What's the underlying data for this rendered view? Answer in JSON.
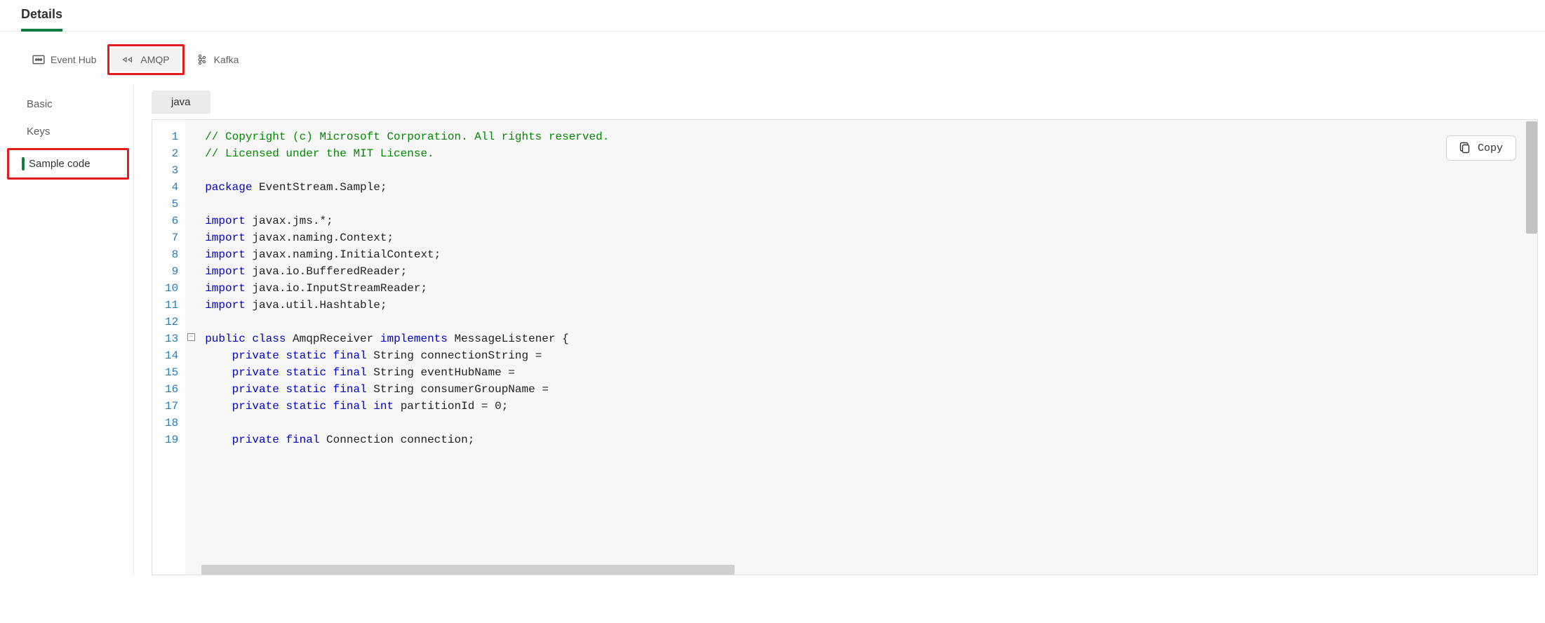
{
  "header": {
    "title": "Details"
  },
  "protocol_tabs": {
    "event_hub": "Event Hub",
    "amqp": "AMQP",
    "kafka": "Kafka"
  },
  "left_nav": {
    "basic": "Basic",
    "keys": "Keys",
    "sample_code": "Sample code"
  },
  "lang_tab": "java",
  "copy_button": "Copy",
  "code": {
    "comment1": "// Copyright (c) Microsoft Corporation. All rights reserved.",
    "comment2": "// Licensed under the MIT License.",
    "pkg_kw": "package",
    "pkg_val": " EventStream.Sample;",
    "import_kw": "import",
    "imp1": " javax.jms.*;",
    "imp2": " javax.naming.Context;",
    "imp3": " javax.naming.InitialContext;",
    "imp4": " java.io.BufferedReader;",
    "imp5": " java.io.InputStreamReader;",
    "imp6": " java.util.Hashtable;",
    "public": "public",
    "class": "class",
    "classname": " AmqpReceiver ",
    "implements": "implements",
    "listener": " MessageListener {",
    "private": "private",
    "static": "static",
    "final": "final",
    "int_kw": "int",
    "str_type": " String ",
    "f1": "connectionString = ",
    "f2": "eventHubName = ",
    "f3": "consumerGroupName = ",
    "f4": " partitionId = 0;",
    "conn_decl": " Connection connection;"
  },
  "line_numbers": [
    "1",
    "2",
    "3",
    "4",
    "5",
    "6",
    "7",
    "8",
    "9",
    "10",
    "11",
    "12",
    "13",
    "14",
    "15",
    "16",
    "17",
    "18",
    "19"
  ]
}
